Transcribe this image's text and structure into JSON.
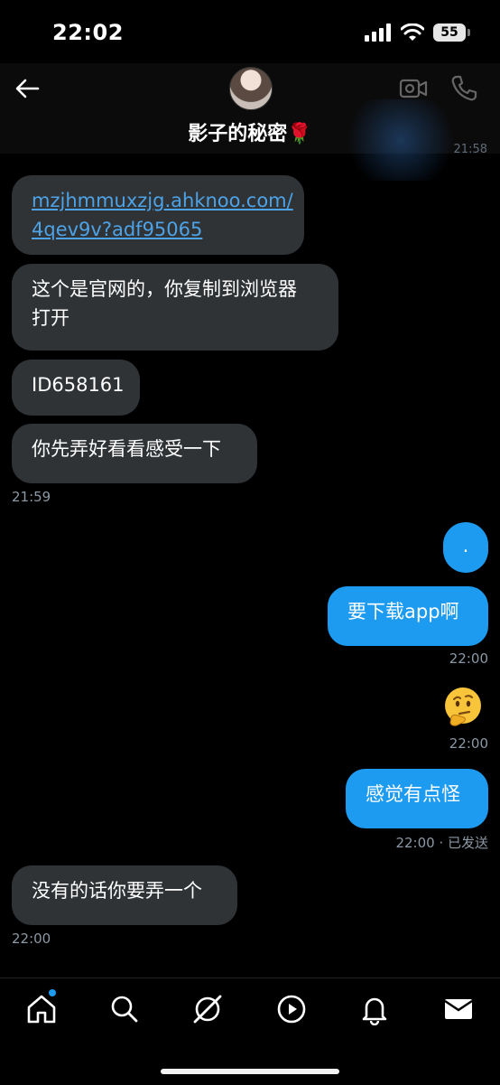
{
  "status": {
    "time": "22:02",
    "battery": "55"
  },
  "chat": {
    "title": "影子的秘密🌹",
    "partial_top_time": "21:58",
    "messages": [
      {
        "dir": "in",
        "text": "mzjhmmuxzjg.ahknoo.com/4qev9v?adf95065",
        "line1": "mzjhmmuxzjg.ahknoo.com/",
        "line2": "4qev9v?adf95065"
      },
      {
        "dir": "in",
        "line1": "这个是官网的，你复制到浏览器",
        "line2": "打开"
      },
      {
        "dir": "in",
        "text": "ID658161"
      },
      {
        "dir": "in",
        "text": "你先弄好看看感受一下"
      },
      {
        "dir": "out",
        "text": "."
      },
      {
        "dir": "out",
        "text": "要下载app啊"
      },
      {
        "dir": "out",
        "text": "🤔"
      },
      {
        "dir": "out",
        "text": "感觉有点怪"
      },
      {
        "dir": "in",
        "text": "没有的话你要弄一个"
      }
    ],
    "stamps": [
      "21:59",
      "22:00",
      "22:00",
      "22:00 · 已发送",
      "22:00"
    ]
  },
  "tabs": [
    "home-icon",
    "search-icon",
    "grok-icon",
    "video-icon",
    "notifications-icon",
    "messages-icon"
  ]
}
